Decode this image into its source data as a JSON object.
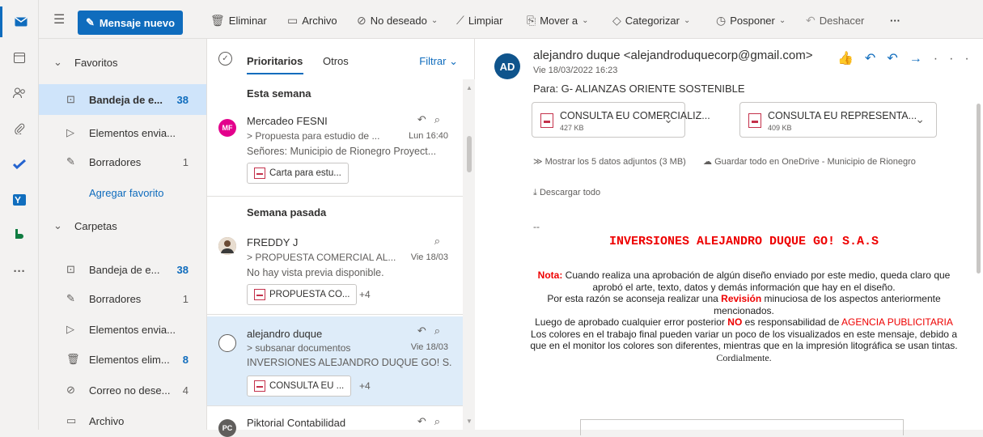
{
  "toolbar": {
    "new_mail": "Mensaje nuevo",
    "delete": "Eliminar",
    "archive": "Archivo",
    "junk": "No deseado",
    "sweep": "Limpiar",
    "move_to": "Mover a",
    "categorize": "Categorizar",
    "snooze": "Posponer",
    "undo": "Deshacer",
    "more": "···"
  },
  "folders": {
    "favorites_header": "Favoritos",
    "fav_inbox": {
      "label": "Bandeja de e...",
      "count": "38"
    },
    "fav_sent": {
      "label": "Elementos envia..."
    },
    "fav_drafts": {
      "label": "Borradores",
      "count": "1"
    },
    "add_favorite": "Agregar favorito",
    "folders_header": "Carpetas",
    "inbox": {
      "label": "Bandeja de e...",
      "count": "38"
    },
    "drafts": {
      "label": "Borradores",
      "count": "1"
    },
    "sent": {
      "label": "Elementos envia..."
    },
    "deleted": {
      "label": "Elementos elim...",
      "count": "8"
    },
    "junk": {
      "label": "Correo no dese...",
      "count": "4"
    },
    "archive": {
      "label": "Archivo"
    }
  },
  "maillist": {
    "tab_focused": "Prioritarios",
    "tab_other": "Otros",
    "filter": "Filtrar",
    "section_this_week": "Esta semana",
    "section_last_week": "Semana pasada",
    "messages": [
      {
        "initials": "MF",
        "avatar_color": "#e3008c",
        "from": "Mercadeo FESNI",
        "subject": "> Propuesta para estudio de ...",
        "time": "Lun 16:40",
        "preview": "Señores: Municipio de Rionegro Proyect...",
        "attachment": "Carta para estu..."
      },
      {
        "initials": "",
        "avatar_color": "#8a6a4f",
        "from": "FREDDY J",
        "subject": "> PROPUESTA COMERCIAL AL...",
        "time": "Vie 18/03",
        "preview": "No hay vista previa disponible.",
        "attachment": "PROPUESTA CO...",
        "extra": "+4"
      },
      {
        "from": "alejandro duque",
        "subject": "> subsanar documentos",
        "time": "Vie 18/03",
        "preview": "INVERSIONES ALEJANDRO DUQUE GO! S...",
        "attachment": "CONSULTA EU ...",
        "extra": "+4"
      },
      {
        "initials": "PC",
        "avatar_color": "#605e5c",
        "from": "Piktorial Contabilidad"
      }
    ]
  },
  "reader": {
    "avatar": "AD",
    "from": "alejandro duque <alejandroduquecorp@gmail.com>",
    "date": "Vie 18/03/2022 16:23",
    "to": "Para:  G- ALIANZAS ORIENTE SOSTENIBLE",
    "attachments": [
      {
        "name": "CONSULTA EU COMERCIALIZ...",
        "size": "427 KB"
      },
      {
        "name": "CONSULTA EU REPRESENTA...",
        "size": "409 KB"
      }
    ],
    "show_attachments": "Mostrar los 5 datos adjuntos (3 MB)",
    "save_onedrive": "Guardar todo en OneDrive - Municipio de Rionegro",
    "download_all": "Descargar todo",
    "dashes": "--",
    "title": "INVERSIONES ALEJANDRO DUQUE GO! S.A.S",
    "nota_label": "Nota:",
    "nota_text": " Cuando realiza una aprobación de algún diseño enviado por este medio, queda claro que aprobó el arte, texto, datos y demás información que hay en el diseño.",
    "line2a": "Por esta razón se aconseja realizar una ",
    "revision": "Revisión",
    "line2b": " minuciosa de los aspectos anteriormente mencionados.",
    "line3a": "Luego de aprobado cualquier error posterior ",
    "no": "NO",
    "line3b": " es responsabilidad de ",
    "agency": "AGENCIA PUBLICITARIA",
    "line4": "Los colores en el trabajo final pueden variar  un poco de los visualizados en este mensaje, debido a que en el monitor los colores son diferentes, mientras que en la impresión litográfica se usan tintas.",
    "closing": "Cordialmente."
  }
}
